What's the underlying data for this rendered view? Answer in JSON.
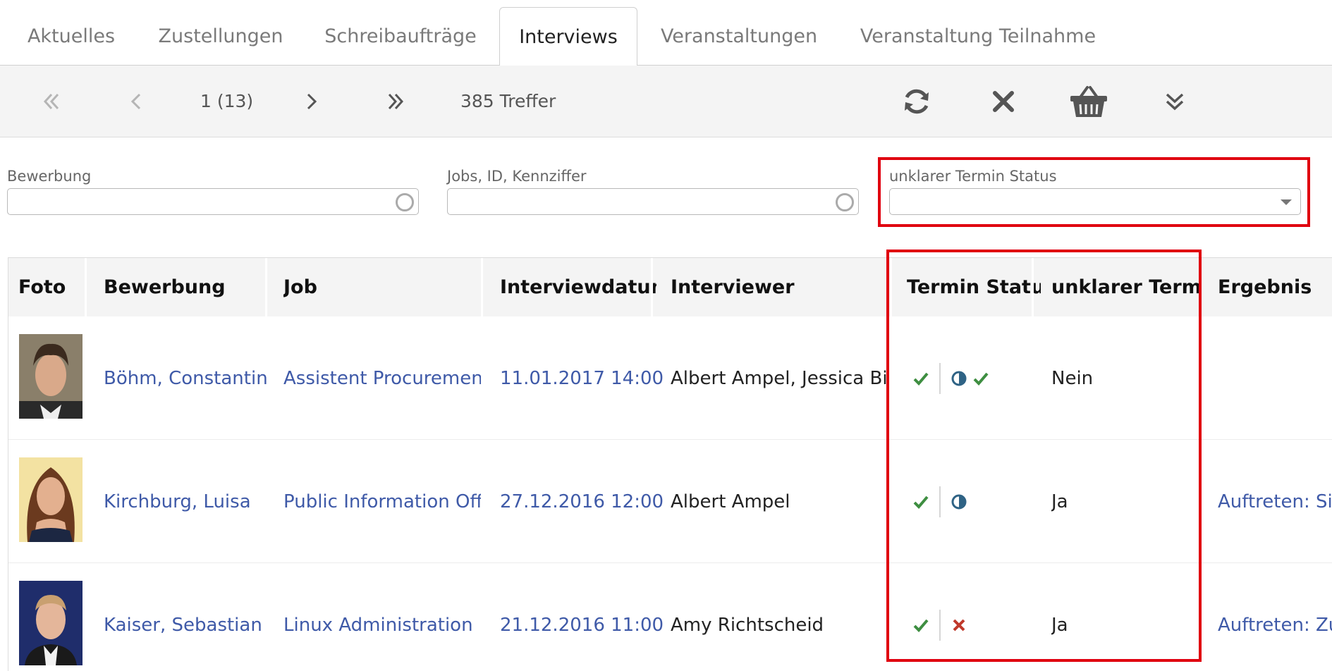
{
  "tabs": [
    {
      "label": "Aktuelles",
      "active": false
    },
    {
      "label": "Zustellungen",
      "active": false
    },
    {
      "label": "Schreibaufträge",
      "active": false
    },
    {
      "label": "Interviews",
      "active": true
    },
    {
      "label": "Veranstaltungen",
      "active": false
    },
    {
      "label": "Veranstaltung Teilnahme",
      "active": false
    }
  ],
  "toolbar": {
    "page_info": "1 (13)",
    "hits": "385 Treffer",
    "icons": [
      "first-page-icon",
      "prev-page-icon",
      "next-page-icon",
      "last-page-icon",
      "refresh-icon",
      "close-icon",
      "basket-icon",
      "expand-down-icon"
    ]
  },
  "filters": {
    "bewerbung": {
      "label": "Bewerbung",
      "value": ""
    },
    "jobs": {
      "label": "Jobs, ID, Kennziffer",
      "value": ""
    },
    "termin_status": {
      "label": "unklarer Termin Status",
      "value": ""
    }
  },
  "table": {
    "headers": [
      "Foto",
      "Bewerbung",
      "Job",
      "Interviewdatum",
      "Interviewer",
      "Termin Status",
      "unklarer Termin",
      "Ergebnis"
    ],
    "rows": [
      {
        "bewerbung": "Böhm, Constantin",
        "job": "Assistent Procurement",
        "datum": "11.01.2017 14:00",
        "interviewer": "Albert Ampel, Jessica Biel",
        "unklar": "Nein",
        "ergebnis": ""
      },
      {
        "bewerbung": "Kirchburg, Luisa",
        "job": "Public Information Offi",
        "datum": "27.12.2016 12:00",
        "interviewer": "Albert Ampel",
        "unklar": "Ja",
        "ergebnis": "Auftreten: Sic"
      },
      {
        "bewerbung": "Kaiser, Sebastian",
        "job": "Linux Administration",
        "datum": "21.12.2016 11:00",
        "interviewer": "Amy Richtscheid",
        "unklar": "Ja",
        "ergebnis": "Auftreten: Zu"
      }
    ]
  },
  "colors": {
    "link": "#3f5aa8",
    "check": "#3e8e41",
    "cross": "#c0392b",
    "half": "#2f6385",
    "highlight": "#e0000f"
  }
}
